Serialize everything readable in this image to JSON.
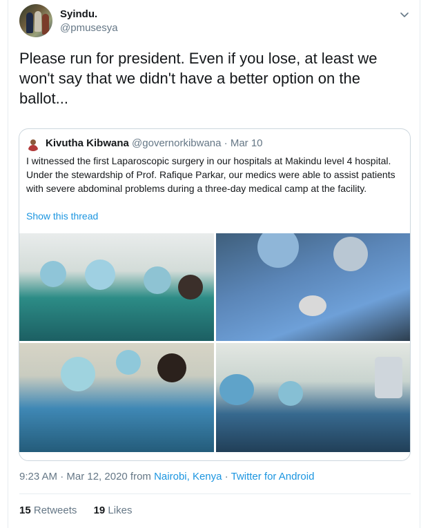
{
  "tweet": {
    "author_name": "Syindu.",
    "author_handle": "@pmusesya",
    "text": "Please run for president. Even if you lose, at least we won't say that we didn't have a better option on the ballot...",
    "timestamp": "9:23 AM · Mar 12, 2020 from",
    "location": "Nairobi, Kenya",
    "separator": "·",
    "source": "Twitter for Android",
    "retweets_count": "15",
    "retweets_label": "Retweets",
    "likes_count": "19",
    "likes_label": "Likes"
  },
  "quoted_tweet": {
    "author_name": "Kivutha Kibwana",
    "author_handle": "@governorkibwana",
    "date": "· Mar 10",
    "text": "I  witnessed the first Laparoscopic surgery in our hospitals at Makindu level 4 hospital. Under the stewardship of Prof. Rafique Parkar, our medics were able to assist patients with severe abdominal problems during a three-day medical camp at the facility.",
    "show_thread_label": "Show this thread",
    "photos": [
      "surgery-team-photo",
      "surgeons-operating-photo",
      "nurse-scrubbing-photo",
      "operating-theatre-photo"
    ]
  },
  "icons": {
    "caret": "chevron-down-icon"
  },
  "colors": {
    "link": "#1b95e0",
    "secondary_text": "#657786",
    "border": "#ccd6dd"
  }
}
